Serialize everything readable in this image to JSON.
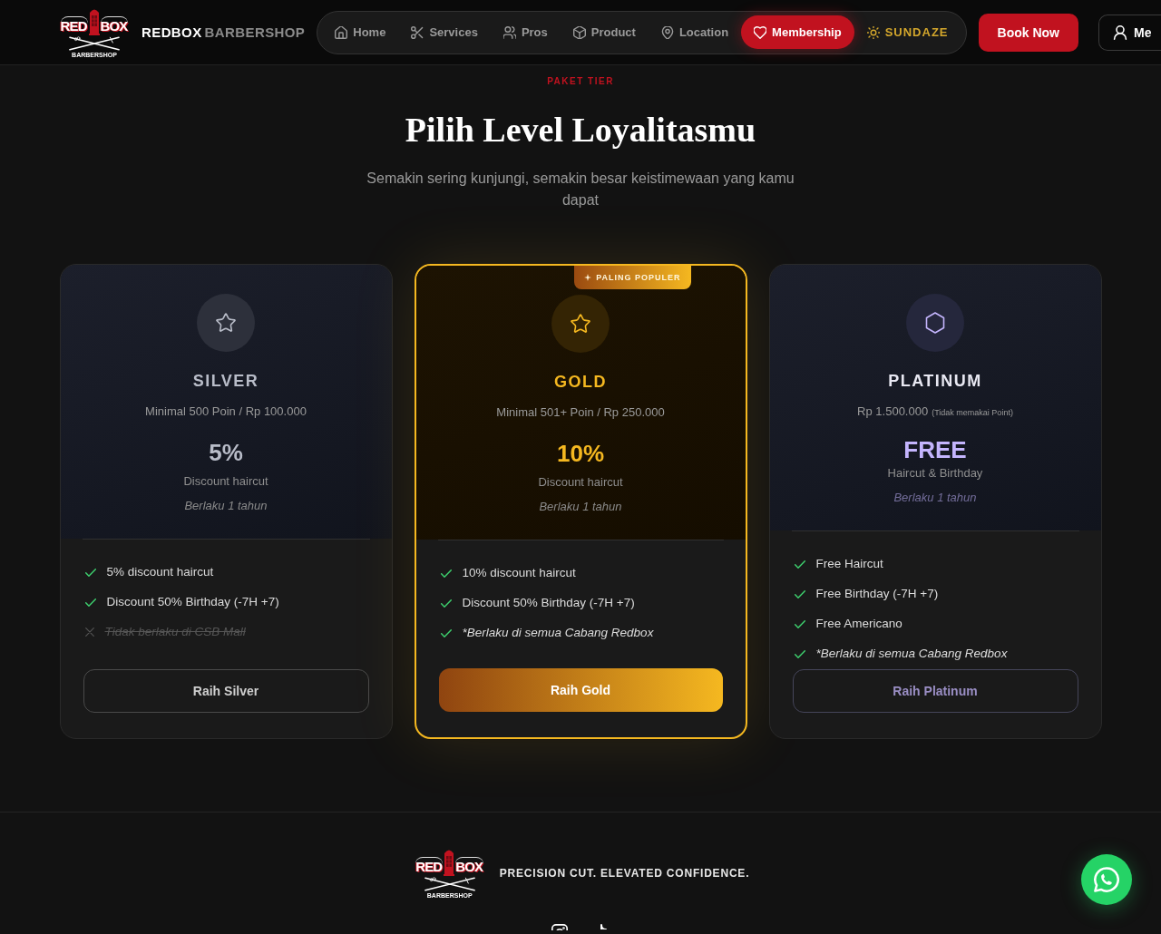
{
  "header": {
    "logo": {
      "word_left": "RED",
      "word_right": "BOX",
      "tagline": "BARBERSHOP"
    },
    "brand": {
      "primary": "REDBOX",
      "secondary": "BARBERSHOP"
    },
    "nav": [
      {
        "label": "Home",
        "kind": "link",
        "selected": false
      },
      {
        "label": "Services",
        "kind": "link",
        "selected": false
      },
      {
        "label": "Pros",
        "kind": "link",
        "selected": false
      },
      {
        "label": "Product",
        "kind": "link",
        "selected": false
      },
      {
        "label": "Location",
        "kind": "link",
        "selected": false
      },
      {
        "label": "Membership",
        "kind": "link",
        "selected": true
      },
      {
        "label": "SUNDAZE",
        "kind": "highlight",
        "selected": false
      }
    ],
    "book_button": "Book Now",
    "account_button": "Me"
  },
  "section": {
    "eyebrow": "PAKET TIER",
    "title": "Pilih Level Loyalitasmu",
    "subtitle": "Semakin sering kunjungi, semakin besar keistimewaan yang kamu dapat"
  },
  "tiers": [
    {
      "kind": "standard",
      "name": "SILVER",
      "color": "#b8bcc8",
      "featured": false,
      "requirement": "Minimal 500 Poin / Rp 100.000",
      "value": "5%",
      "value_caption": "Discount haircut",
      "validity": "Berlaku 1 tahun",
      "features": [
        {
          "kind": "benefit",
          "text": "5% discount haircut"
        },
        {
          "kind": "benefit",
          "text": "Discount 50% Birthday (-7H +7)"
        },
        {
          "kind": "excluded",
          "text": "Tidak berlaku di CSB Mall"
        }
      ],
      "button": "Raih Silver"
    },
    {
      "kind": "standard",
      "name": "GOLD",
      "color": "#f5b820",
      "featured": true,
      "badge": "PALING POPULER",
      "requirement": "Minimal 501+ Poin / Rp 250.000",
      "value": "10%",
      "value_caption": "Discount haircut",
      "validity": "Berlaku 1 tahun",
      "features": [
        {
          "kind": "benefit",
          "text": "10% discount haircut"
        },
        {
          "kind": "benefit",
          "text": "Discount 50% Birthday (-7H +7)"
        },
        {
          "kind": "note",
          "text": "*Berlaku di semua Cabang Redbox"
        }
      ],
      "button": "Raih Gold"
    },
    {
      "kind": "premium",
      "name": "PLATINUM",
      "color": "#c4b5fd",
      "featured": false,
      "requirement": "Rp 1.500.000",
      "requirement_note": "(Tidak memakai Point)",
      "value": "FREE",
      "value_caption": "Haircut & Birthday",
      "validity": "Berlaku 1 tahun",
      "features": [
        {
          "kind": "benefit",
          "text": "Free Haircut"
        },
        {
          "kind": "benefit",
          "text": "Free Birthday (-7H +7)"
        },
        {
          "kind": "benefit",
          "text": "Free Americano"
        },
        {
          "kind": "note",
          "text": "*Berlaku di semua Cabang Redbox"
        }
      ],
      "button": "Raih Platinum"
    }
  ],
  "footer": {
    "logo": {
      "word_left": "RED",
      "word_right": "BOX",
      "tagline": "BARBERSHOP"
    },
    "tagline": "PRECISION CUT. ELEVATED CONFIDENCE."
  }
}
